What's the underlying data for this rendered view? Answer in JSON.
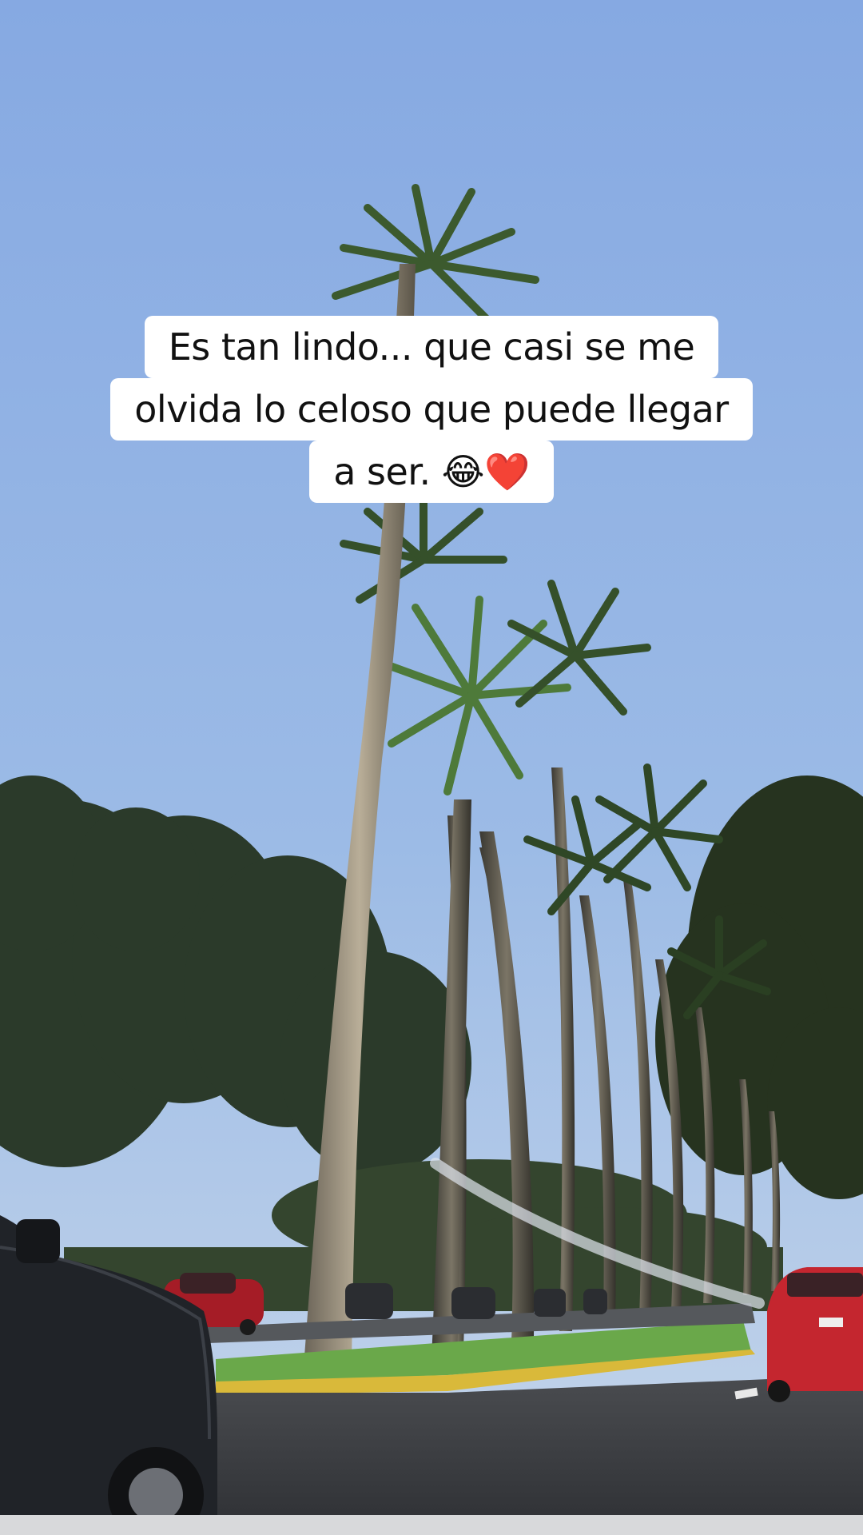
{
  "caption": {
    "lines": [
      "Es tan lindo... que casi se me",
      "olvida lo celoso que puede llegar",
      "a ser. 😂❤️"
    ]
  },
  "scene": {
    "description_icons": [
      "palm-tree-icon",
      "car-icon"
    ],
    "colors": {
      "sky_top": "#86a9e2",
      "sky_bottom": "#b9cde9",
      "foliage": "#2d3a2c",
      "grass": "#6aa84a",
      "road": "#3a3c40",
      "curb": "#d9b93a",
      "red_car": "#c4262f",
      "dark_car": "#202328"
    }
  }
}
